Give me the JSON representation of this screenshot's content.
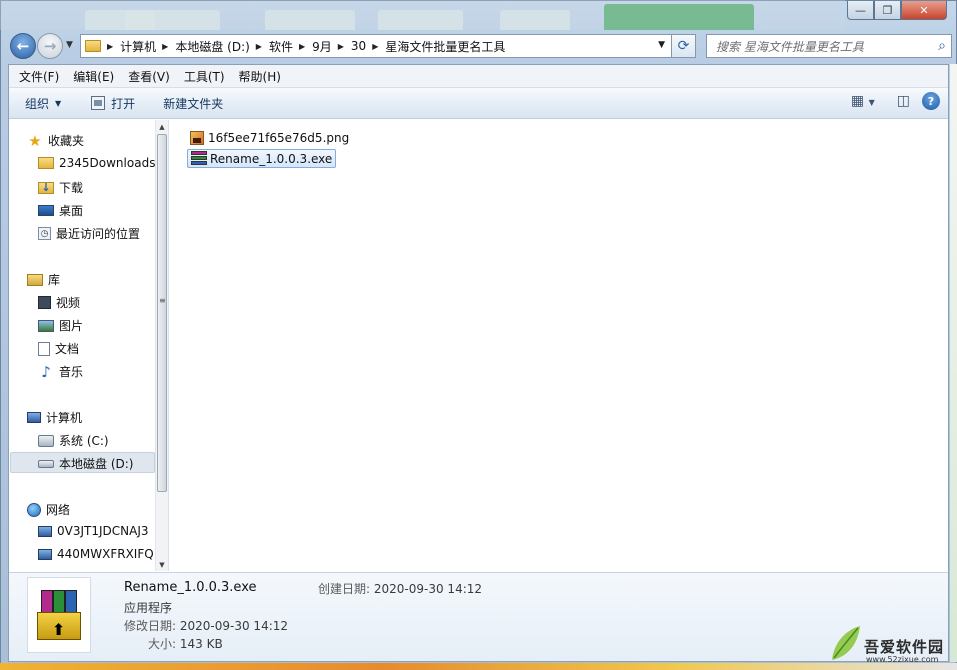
{
  "window": {
    "caption_buttons": {
      "minimize": "—",
      "maximize": "❐",
      "close": "✕"
    }
  },
  "address": {
    "crumbs": [
      "计算机",
      "本地磁盘 (D:)",
      "软件",
      "9月",
      "30",
      "星海文件批量更名工具"
    ]
  },
  "search": {
    "placeholder": "搜索 星海文件批量更名工具"
  },
  "menu": [
    "文件(F)",
    "编辑(E)",
    "查看(V)",
    "工具(T)",
    "帮助(H)"
  ],
  "toolbar": {
    "organize": "组织",
    "open": "打开",
    "new_folder": "新建文件夹"
  },
  "nav": {
    "favorites": "收藏夹",
    "fav_items": [
      "2345Downloads",
      "下载",
      "桌面",
      "最近访问的位置"
    ],
    "libraries": "库",
    "lib_items": [
      "视频",
      "图片",
      "文档",
      "音乐"
    ],
    "computer": "计算机",
    "computer_items": [
      "系统 (C:)",
      "本地磁盘 (D:)"
    ],
    "network": "网络",
    "network_items": [
      "0V3JT1JDCNAJ3",
      "440MWXFRXIFQ"
    ]
  },
  "files": [
    {
      "name": "16f5ee71f65e76d5.png",
      "type": "png",
      "selected": false
    },
    {
      "name": "Rename_1.0.0.3.exe",
      "type": "exe",
      "selected": true
    }
  ],
  "details": {
    "name": "Rename_1.0.0.3.exe",
    "type": "应用程序",
    "modified_label": "修改日期:",
    "modified": "2020-09-30 14:12",
    "size_label": "大小:",
    "size": "143 KB",
    "created_label": "创建日期:",
    "created": "2020-09-30 14:12"
  },
  "watermark": {
    "title": "吾爱软件园",
    "url": "www.52zixue.com"
  }
}
